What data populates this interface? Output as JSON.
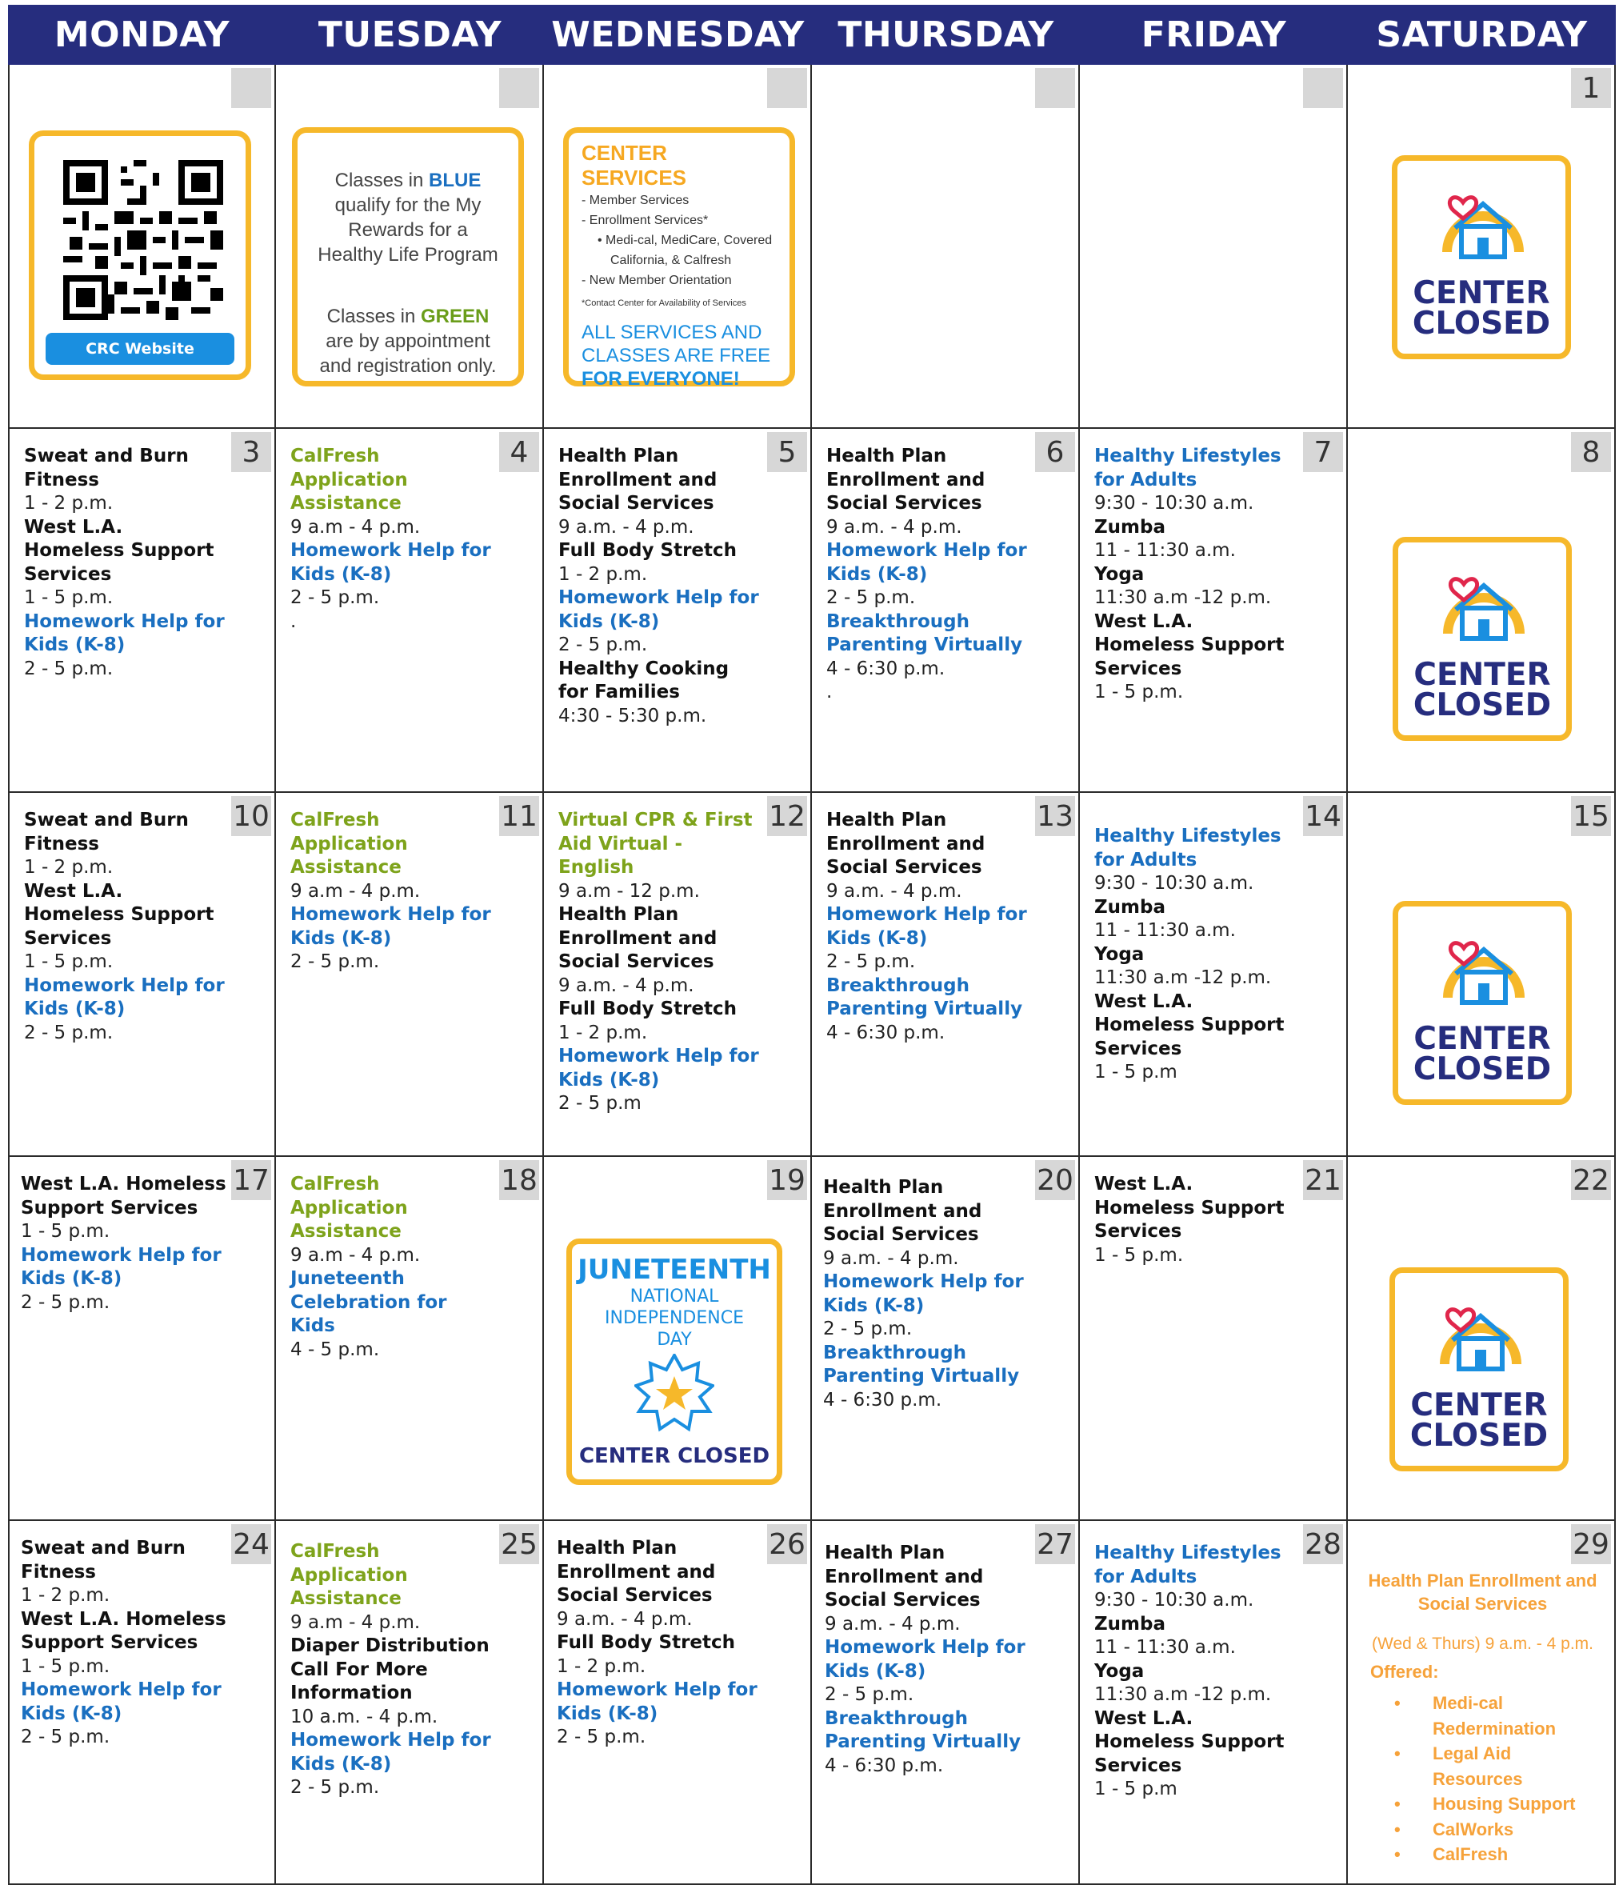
{
  "days": [
    "MONDAY",
    "TUESDAY",
    "WEDNESDAY",
    "THURSDAY",
    "FRIDAY",
    "SATURDAY"
  ],
  "qr": {
    "button": "CRC Website"
  },
  "classes_info": {
    "p1_pre": "Classes in ",
    "p1_color": "BLUE",
    "p1_post": " qualify for the My Rewards for a Healthy Life Program",
    "p2_pre": "Classes in ",
    "p2_color": "GREEN",
    "p2_post": " are by appointment and registration only."
  },
  "services_info": {
    "title": "CENTER SERVICES",
    "items": [
      "-    Member Services",
      "-    Enrollment Services*",
      "•  Medi-cal, MediCare, Covered",
      "California, & Calfresh",
      "-    New Member Orientation"
    ],
    "note": "*Contact Center for Availability of Services",
    "free_1": "ALL SERVICES AND",
    "free_2": "CLASSES ARE FREE",
    "free_3": "FOR EVERYONE!"
  },
  "closed_label_1": "CENTER",
  "closed_label_2": "CLOSED",
  "juneteenth": {
    "title": "JUNETEENTH",
    "sub1": "NATIONAL",
    "sub2": "INDEPENDENCE",
    "sub3": "DAY",
    "closed": "CENTER CLOSED"
  },
  "weeks": [
    {
      "dates": [
        "",
        "",
        "",
        "",
        "",
        "1"
      ]
    },
    {
      "dates": [
        "3",
        "4",
        "5",
        "6",
        "7",
        "8"
      ]
    },
    {
      "dates": [
        "10",
        "11",
        "12",
        "13",
        "14",
        "15"
      ]
    },
    {
      "dates": [
        "17",
        "18",
        "19",
        "20",
        "21",
        "22"
      ]
    },
    {
      "dates": [
        "24",
        "25",
        "26",
        "27",
        "28",
        "29"
      ]
    }
  ],
  "events": {
    "w2_mon": [
      [
        "t-black",
        "Sweat and Burn Fitness"
      ],
      [
        "t-time",
        "1 - 2 p.m."
      ],
      [
        "t-black",
        "West L.A. Homeless Support Services"
      ],
      [
        "t-time",
        "1 - 5 p.m."
      ],
      [
        "t-blue",
        "Homework Help for Kids (K-8)"
      ],
      [
        "t-time",
        "2 - 5 p.m."
      ]
    ],
    "w2_tue": [
      [
        "t-green",
        "CalFresh Application Assistance"
      ],
      [
        "t-time",
        "9 a.m - 4 p.m."
      ],
      [
        "t-blue",
        "Homework Help for Kids (K-8)"
      ],
      [
        "t-time",
        "2 - 5 p.m."
      ],
      [
        "t-time",
        "."
      ]
    ],
    "w2_wed": [
      [
        "t-black",
        "Health Plan Enrollment and Social Services"
      ],
      [
        "t-time",
        "9 a.m. - 4 p.m."
      ],
      [
        "t-black",
        "Full Body Stretch"
      ],
      [
        "t-time",
        "1 - 2 p.m."
      ],
      [
        "t-blue",
        "Homework Help for Kids (K-8)"
      ],
      [
        "t-time",
        "2 - 5 p.m."
      ],
      [
        "t-black",
        "Healthy Cooking for Families"
      ],
      [
        "t-time",
        "4:30 - 5:30 p.m."
      ]
    ],
    "w2_thu": [
      [
        "t-black",
        "Health Plan Enrollment and Social Services"
      ],
      [
        "t-time",
        "9 a.m. - 4 p.m."
      ],
      [
        "t-blue",
        "Homework Help for Kids (K-8)"
      ],
      [
        "t-time",
        "2 - 5 p.m."
      ],
      [
        "t-blue",
        "Breakthrough Parenting Virtually"
      ],
      [
        "t-time",
        " 4 - 6:30 p.m."
      ],
      [
        "t-time",
        "."
      ]
    ],
    "w2_fri": [
      [
        "t-blue",
        "Healthy Lifestyles for Adults"
      ],
      [
        "t-time",
        "9:30 - 10:30 a.m."
      ],
      [
        "t-black",
        "Zumba"
      ],
      [
        "t-time",
        "11 - 11:30 a.m."
      ],
      [
        "t-black",
        "Yoga"
      ],
      [
        "t-time",
        "11:30 a.m -12 p.m."
      ],
      [
        "t-black",
        "West L.A. Homeless Support Services"
      ],
      [
        "t-time",
        "1 - 5 p.m."
      ]
    ],
    "w3_mon": [
      [
        "t-black",
        "Sweat and Burn Fitness"
      ],
      [
        "t-time",
        "1 - 2 p.m."
      ],
      [
        "t-black",
        "West L.A. Homeless Support Services"
      ],
      [
        "t-time",
        "1 - 5 p.m."
      ],
      [
        "t-blue",
        "Homework Help for Kids (K-8)"
      ],
      [
        "t-time",
        "2 - 5 p.m."
      ]
    ],
    "w3_tue": [
      [
        "t-green",
        "CalFresh Application Assistance"
      ],
      [
        "t-time",
        "9 a.m - 4 p.m."
      ],
      [
        "t-blue",
        "Homework Help for Kids (K-8)"
      ],
      [
        "t-time",
        "2 - 5 p.m."
      ]
    ],
    "w3_wed": [
      [
        "t-green",
        "Virtual CPR & First Aid Virtual - English"
      ],
      [
        "t-time",
        "9 a.m - 12 p.m."
      ],
      [
        "t-black",
        "Health Plan Enrollment and Social Services"
      ],
      [
        "t-time",
        "9 a.m. - 4 p.m."
      ],
      [
        "t-black",
        "Full Body Stretch"
      ],
      [
        "t-time",
        "1 - 2 p.m."
      ],
      [
        "t-blue",
        "Homework Help for Kids (K-8)"
      ],
      [
        "t-time",
        "2 - 5 p.m"
      ]
    ],
    "w3_thu": [
      [
        "t-black",
        "Health Plan Enrollment and Social Services"
      ],
      [
        "t-time",
        "9 a.m. - 4 p.m."
      ],
      [
        "t-blue",
        "Homework Help for Kids (K-8)"
      ],
      [
        "t-time",
        "2 - 5 p.m."
      ],
      [
        "t-blue",
        "Breakthrough Parenting Virtually"
      ],
      [
        "t-time",
        " 4 - 6:30 p.m."
      ]
    ],
    "w3_fri": [
      [
        "t-blue",
        "Healthy Lifestyles for Adults"
      ],
      [
        "t-time",
        "9:30 - 10:30 a.m."
      ],
      [
        "t-black",
        "Zumba"
      ],
      [
        "t-time",
        "11 - 11:30 a.m."
      ],
      [
        "t-black",
        "Yoga"
      ],
      [
        "t-time",
        "11:30 a.m -12 p.m."
      ],
      [
        "t-black",
        "West L.A. Homeless Support Services"
      ],
      [
        "t-time",
        "1 - 5 p.m"
      ]
    ],
    "w4_mon": [
      [
        "t-black",
        "West L.A. Homeless Support Services"
      ],
      [
        "t-time",
        "1 - 5 p.m."
      ],
      [
        "t-blue",
        "Homework Help for Kids (K-8)"
      ],
      [
        "t-time",
        "2 - 5 p.m."
      ]
    ],
    "w4_tue": [
      [
        "t-green",
        "CalFresh Application Assistance"
      ],
      [
        "t-time",
        "9 a.m - 4 p.m."
      ],
      [
        "t-blue",
        "Juneteenth Celebration for Kids"
      ],
      [
        "t-time",
        "4 - 5 p.m."
      ]
    ],
    "w4_thu": [
      [
        "t-black",
        "Health Plan Enrollment and Social Services"
      ],
      [
        "t-time",
        "9 a.m. - 4 p.m."
      ],
      [
        "t-blue",
        "Homework Help for Kids (K-8)"
      ],
      [
        "t-time",
        "2 - 5 p.m."
      ],
      [
        "t-blue",
        "Breakthrough Parenting Virtually"
      ],
      [
        "t-time",
        " 4 - 6:30 p.m."
      ]
    ],
    "w4_fri": [
      [
        "t-black",
        "West L.A. Homeless Support Services"
      ],
      [
        "t-time",
        "1 - 5 p.m."
      ]
    ],
    "w5_mon": [
      [
        "t-black",
        "Sweat and Burn Fitness"
      ],
      [
        "t-time",
        "1 - 2 p.m."
      ],
      [
        "t-black",
        "West L.A. Homeless Support Services"
      ],
      [
        "t-time",
        "1 - 5 p.m."
      ],
      [
        "t-blue",
        "Homework Help for Kids (K-8)"
      ],
      [
        "t-time",
        "2 - 5 p.m."
      ]
    ],
    "w5_tue": [
      [
        "t-green",
        "CalFresh Application Assistance"
      ],
      [
        "t-time",
        "9 a.m - 4 p.m."
      ],
      [
        "t-black",
        "Diaper Distribution Call For More Information"
      ],
      [
        "t-time",
        "10 a.m. - 4 p.m."
      ],
      [
        "t-blue",
        "Homework Help for Kids (K-8)"
      ],
      [
        "t-time",
        "2 - 5 p.m."
      ]
    ],
    "w5_wed": [
      [
        "t-black",
        "Health Plan Enrollment and Social Services"
      ],
      [
        "t-time",
        "9 a.m. - 4 p.m."
      ],
      [
        "t-black",
        "Full Body Stretch"
      ],
      [
        "t-time",
        "1 - 2 p.m."
      ],
      [
        "t-blue",
        "Homework Help for Kids (K-8)"
      ],
      [
        "t-time",
        "2 - 5 p.m."
      ]
    ],
    "w5_thu": [
      [
        "t-black",
        "Health Plan Enrollment and Social Services"
      ],
      [
        "t-time",
        "9 a.m. - 4 p.m."
      ],
      [
        "t-blue",
        "Homework Help for Kids (K-8)"
      ],
      [
        "t-time",
        "2 - 5 p.m."
      ],
      [
        "t-blue",
        "Breakthrough Parenting Virtually"
      ],
      [
        "t-time",
        " 4 - 6:30 p.m."
      ]
    ],
    "w5_fri": [
      [
        "t-blue",
        "Healthy Lifestyles for Adults"
      ],
      [
        "t-time",
        "9:30 - 10:30 a.m."
      ],
      [
        "t-black",
        "Zumba"
      ],
      [
        "t-time",
        "11 - 11:30 a.m."
      ],
      [
        "t-black",
        "Yoga"
      ],
      [
        "t-time",
        "11:30 a.m -12 p.m."
      ],
      [
        "t-black",
        "West L.A. Homeless Support Services"
      ],
      [
        "t-time",
        "1 - 5 p.m"
      ]
    ]
  },
  "sat29": {
    "title": "Health Plan Enrollment and Social Services",
    "sub": "(Wed & Thurs) 9 a.m. - 4 p.m.",
    "offered": "Offered:",
    "list": [
      "Medi-cal Redermination",
      "Legal Aid Resources",
      "Housing Support",
      "CalWorks",
      "CalFresh"
    ]
  },
  "colors": {
    "header": "#262d7e",
    "blue": "#1a6fc0",
    "green": "#7ea31b",
    "gold": "#f6b82a",
    "orange": "#f6a23a"
  }
}
